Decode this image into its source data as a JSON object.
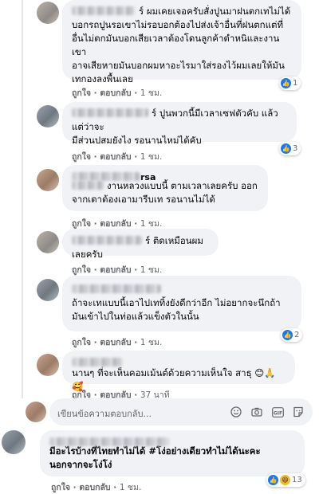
{
  "comments": [
    {
      "text_lines": [
        "ร์ ผมเคยเจอครับสั่งปูนมาฝนตกเทไม่ได้",
        "บอกรถปูนรอเขาไม่รอบอกต้องไปส่งเจ้าอื่นที่ฝนตกแต่ที่",
        "อื่นไม่ตกมันบอกเสียเวลาต้องโดนลูกค้าตำหนิและงานเขา",
        "อาจเสียหายมันบอกผมหาอะไรมาใส่รองไว้ผมเลยให้มัน",
        "เทกองลงพื้นเลย"
      ],
      "like": "ถูกใจ",
      "reply": "ตอบกลับ",
      "time": "1 ชม.",
      "reaction_count": "1"
    },
    {
      "text_lines": [
        "ร์ ปูนพวกนี้มีเวลาเซฟตัวคับ แล้วแต่ว่าจะ",
        "มีส่วนปสมยังไง รอนานไหม่ได้คับ"
      ],
      "like": "ถูกใจ",
      "reply": "ตอบกลับ",
      "time": "1 ชม.",
      "reaction_count": "3"
    },
    {
      "name_tail": "rsa",
      "text_lines": [
        "งานหลวงแบบนี้ ตามเวลาเลยครับ ออก",
        "จากเตาต้องเอามารีบเท รอนานไม่ได้"
      ],
      "like": "ถูกใจ",
      "reply": "ตอบกลับ",
      "time": "1 ชม."
    },
    {
      "text_lines": [
        "ร์ ติดเหมือนผมเลยครับ"
      ],
      "like": "ถูกใจ",
      "reply": "ตอบกลับ",
      "time": "1 ชม."
    },
    {
      "text_lines": [
        "ถ้าจะเทแบบนี้เอาไปเททิ้งยังดีกว่าอีก ไม่อยากจะนึกถ้า",
        "มันเข้าไปในท่อแล้วแข็งตัวในนั้น"
      ],
      "like": "ถูกใจ",
      "reply": "ตอบกลับ",
      "time": "1 ชม.",
      "reaction_count": "2"
    },
    {
      "text_lines": [
        "นานๆ ที่จะเห็นคอมเม้นต์ด้วยความเห็นใจ สาธุ 😊🙏🥰"
      ],
      "like": "ถูกใจ",
      "reply": "ตอบกลับ",
      "time": "37 นาที"
    }
  ],
  "reply_box": {
    "placeholder": "เขียนข้อความตอบกลับ...",
    "icons": [
      "emoji-icon",
      "camera-icon",
      "gif-icon",
      "sticker-icon"
    ]
  },
  "top_comment": {
    "text_lines": [
      "มีอะไรบ้างที่ไทยทำไม่ได้ #โง่อย่างเดียวทำไม่ได้นะคะ",
      "นอกจากจะโง่โง่"
    ],
    "like": "ถูกใจ",
    "reply": "ตอบกลับ",
    "time": "1 ชม.",
    "reaction_count": "13"
  }
}
